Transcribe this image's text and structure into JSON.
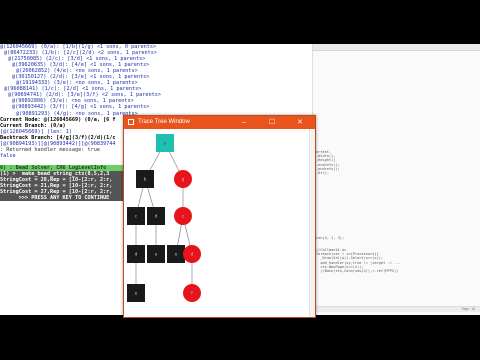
{
  "console": {
    "lines": [
      {
        "text": "@(126045669) (0/a): [1/b](1/g) <1 sons, 0 parents>",
        "indent": 0,
        "style": "c-blue"
      },
      {
        "text": "@(86472233) (1/b): [2/c](2/d) <2 sons, 1 parents>",
        "indent": 1,
        "style": "c-blue"
      },
      {
        "text": "@(21750085) (2/c): [3/d] <1 sons, 1 parents>",
        "indent": 2,
        "style": "c-blue"
      },
      {
        "text": "@(39620635) (3/d): [4/e] <1 sons, 1 parents>",
        "indent": 3,
        "style": "c-blue"
      },
      {
        "text": "@(26062852) (4/e): <no sons, 1 parents>",
        "indent": 4,
        "style": "c-blue"
      },
      {
        "text": "@(30150127) (2/d): [3/e] <1 sons, 1 parents>",
        "indent": 3,
        "style": "c-blue"
      },
      {
        "text": "@(19194333) (3/e): <no sons, 1 parents>",
        "indent": 4,
        "style": "c-blue"
      },
      {
        "text": "@(96088141) (1/c): [2/d] <1 sons, 1 parents>",
        "indent": 1,
        "style": "c-blue"
      },
      {
        "text": "@(90694741) (2/d): [3/e](3/f) <2 sons, 1 parents>",
        "indent": 2,
        "style": "c-blue"
      },
      {
        "text": "@(90892806) (3/e): <no sons, 1 parents>",
        "indent": 3,
        "style": "c-blue"
      },
      {
        "text": "@(90893442) (3/f): [4/g] <1 sons, 1 parents>",
        "indent": 3,
        "style": "c-blue"
      },
      {
        "text": "@(90891293) (4/g): <no sons, 1 parents>",
        "indent": 4,
        "style": "c-blue"
      },
      {
        "text": "Current Node: @(126045669) (0/a, [6 f",
        "indent": 0,
        "style": "c-dark"
      },
      {
        "text": "Current Branch: (0/a)",
        "indent": 0,
        "style": "c-dark"
      },
      {
        "text": "[@(126045669)] (len: 1)",
        "indent": 0,
        "style": "c-blue"
      },
      {
        "text": "Backtrack Branch: [4/g](3/f)(2/d)(1/c",
        "indent": 0,
        "style": "c-dark"
      },
      {
        "text": "[@(90894193)][@(90893442)][@(90839744",
        "indent": 0,
        "style": "c-blue"
      },
      {
        "text": ": Returned handler message: true",
        "indent": 0,
        "style": ""
      },
      {
        "text": "false",
        "indent": 0,
        "style": "c-blue"
      },
      {
        "text": "",
        "indent": 0,
        "style": ""
      },
      {
        "text": "6) : Bead Solver, CH6 LogLevelInfo",
        "indent": 0,
        "style": "hl-green"
      },
      {
        "text": "(1) >  make_bead_string_ctx(8,5,2,3",
        "indent": 0,
        "style": "hl-gray"
      },
      {
        "text": "StringCost = 28,Rep = [10-[2:r, 2:r,",
        "indent": 0,
        "style": "hl-gray"
      },
      {
        "text": "StringCost = 21,Rep = [10-[2:r, 2:r,",
        "indent": 0,
        "style": "hl-gray"
      },
      {
        "text": "StringCost = 27,Rep = [10-[2:r, 2:r,",
        "indent": 0,
        "style": "hl-gray"
      },
      {
        "text": "      >>> PRESS ANY KEY TO CONTINUE",
        "indent": 0,
        "style": "hl-gray"
      }
    ]
  },
  "editor": {
    "block1": "ortest,\n.Width(),\n.Height()\n.endrefs();\n.endrefs();\n.Dir);",
    "block2": "Len(4, 1, 3);",
    "block3": "//CallbackI.oc\nforeach(var l in(Processors){\n  _Draw(Val(p)).Select(x=>(x));\n  add_handler(xy,true != (target -> ...\n  ctx.NewPage(x=>(x));\n  //Back(ctx,Conn(new(2)),r.ref(PPP2))",
    "page_info": "Page 10"
  },
  "window": {
    "title": "Trace Tree Window",
    "minimize": "–",
    "maximize": "☐",
    "close": "✕",
    "nodes": [
      {
        "id": "a",
        "label": "a",
        "shape": "square",
        "fill": "#20c0b0"
      },
      {
        "id": "b",
        "label": "b",
        "shape": "square",
        "fill": "#1a1a1a"
      },
      {
        "id": "g",
        "label": "g",
        "shape": "circle",
        "fill": "#e8141c"
      },
      {
        "id": "c1",
        "label": "c",
        "shape": "square",
        "fill": "#1a1a1a"
      },
      {
        "id": "d1",
        "label": "d",
        "shape": "square",
        "fill": "#1a1a1a"
      },
      {
        "id": "c2",
        "label": "c",
        "shape": "circle",
        "fill": "#e8141c"
      },
      {
        "id": "d2",
        "label": "d",
        "shape": "square",
        "fill": "#1a1a1a"
      },
      {
        "id": "e1",
        "label": "e",
        "shape": "square",
        "fill": "#1a1a1a"
      },
      {
        "id": "e2",
        "label": "e",
        "shape": "square",
        "fill": "#1a1a1a"
      },
      {
        "id": "d3",
        "label": "d",
        "shape": "circle",
        "fill": "#e8141c"
      },
      {
        "id": "e3",
        "label": "e",
        "shape": "square",
        "fill": "#1a1a1a"
      },
      {
        "id": "f",
        "label": "f",
        "shape": "circle",
        "fill": "#e8141c"
      }
    ]
  }
}
